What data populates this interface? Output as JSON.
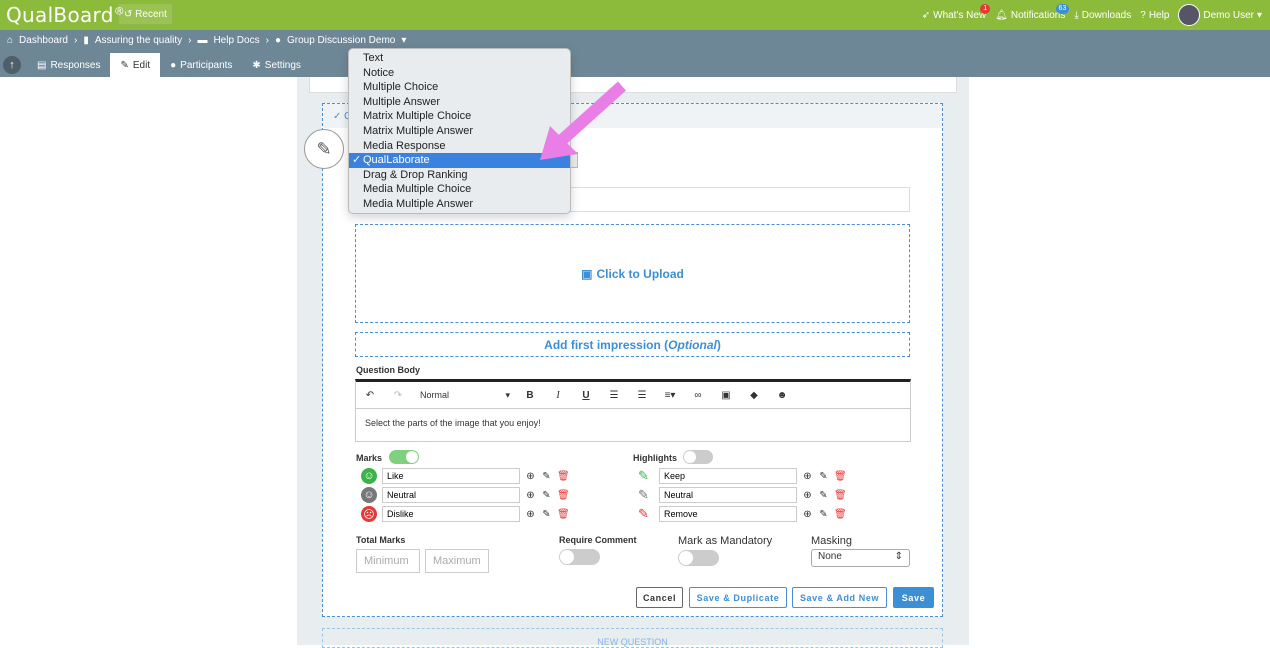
{
  "app": {
    "logo": "QualBoard",
    "logo_mark": "®",
    "recent": "Recent"
  },
  "topnav": {
    "whats_new": "What's New",
    "whats_new_badge": "1",
    "notifications": "Notifications",
    "notifications_badge": "63",
    "downloads": "Downloads",
    "help": "Help",
    "user": "Demo User"
  },
  "breadcrumb": [
    "Dashboard",
    "Assuring the quality",
    "Help Docs",
    "Group Discussion Demo"
  ],
  "tabs": {
    "responses": "Responses",
    "edit": "Edit",
    "participants": "Participants",
    "settings": "Settings"
  },
  "question_header": "Q",
  "question_type_options": [
    "Text",
    "Notice",
    "Multiple Choice",
    "Multiple Answer",
    "Matrix Multiple Choice",
    "Matrix Multiple Answer",
    "Media Response",
    "QualLaborate",
    "Drag & Drop Ranking",
    "Media Multiple Choice",
    "Media Multiple Answer"
  ],
  "question_type_selected": "QualLaborate",
  "upload_label": "Click to Upload",
  "impression": {
    "label": "Add first impression (",
    "optional": "Optional",
    "close": ")"
  },
  "question_body": {
    "label": "Question Body",
    "format": "Normal",
    "text": "Select the parts of the image that you enjoy!"
  },
  "marks": {
    "label": "Marks",
    "enabled": true,
    "items": [
      {
        "label": "Like",
        "icon": "smile-icon",
        "color": "#3bb34a"
      },
      {
        "label": "Neutral",
        "icon": "neutral-face-icon",
        "color": "#777777"
      },
      {
        "label": "Dislike",
        "icon": "frown-icon",
        "color": "#e53935"
      }
    ]
  },
  "highlights": {
    "label": "Highlights",
    "enabled": false,
    "items": [
      {
        "label": "Keep",
        "icon": "highlighter-icon",
        "color": "#3bb34a"
      },
      {
        "label": "Neutral",
        "icon": "highlighter-icon",
        "color": "#777777"
      },
      {
        "label": "Remove",
        "icon": "highlighter-icon",
        "color": "#e53935"
      }
    ]
  },
  "total_marks": {
    "label": "Total Marks",
    "min_placeholder": "Minimum",
    "max_placeholder": "Maximum"
  },
  "require_comment": {
    "label": "Require Comment",
    "enabled": false
  },
  "mark_mandatory": {
    "label": "Mark as Mandatory",
    "enabled": false
  },
  "masking": {
    "label": "Masking",
    "value": "None"
  },
  "buttons": {
    "cancel": "Cancel",
    "save_duplicate": "Save & Duplicate",
    "save_add_new": "Save & Add New",
    "save": "Save"
  },
  "new_question": "NEW QUESTION",
  "colors": {
    "brand_green": "#8cbb3c",
    "subnav": "#6e8797",
    "accent_blue": "#3d8fd5",
    "annotation_arrow": "#e97ee6"
  }
}
